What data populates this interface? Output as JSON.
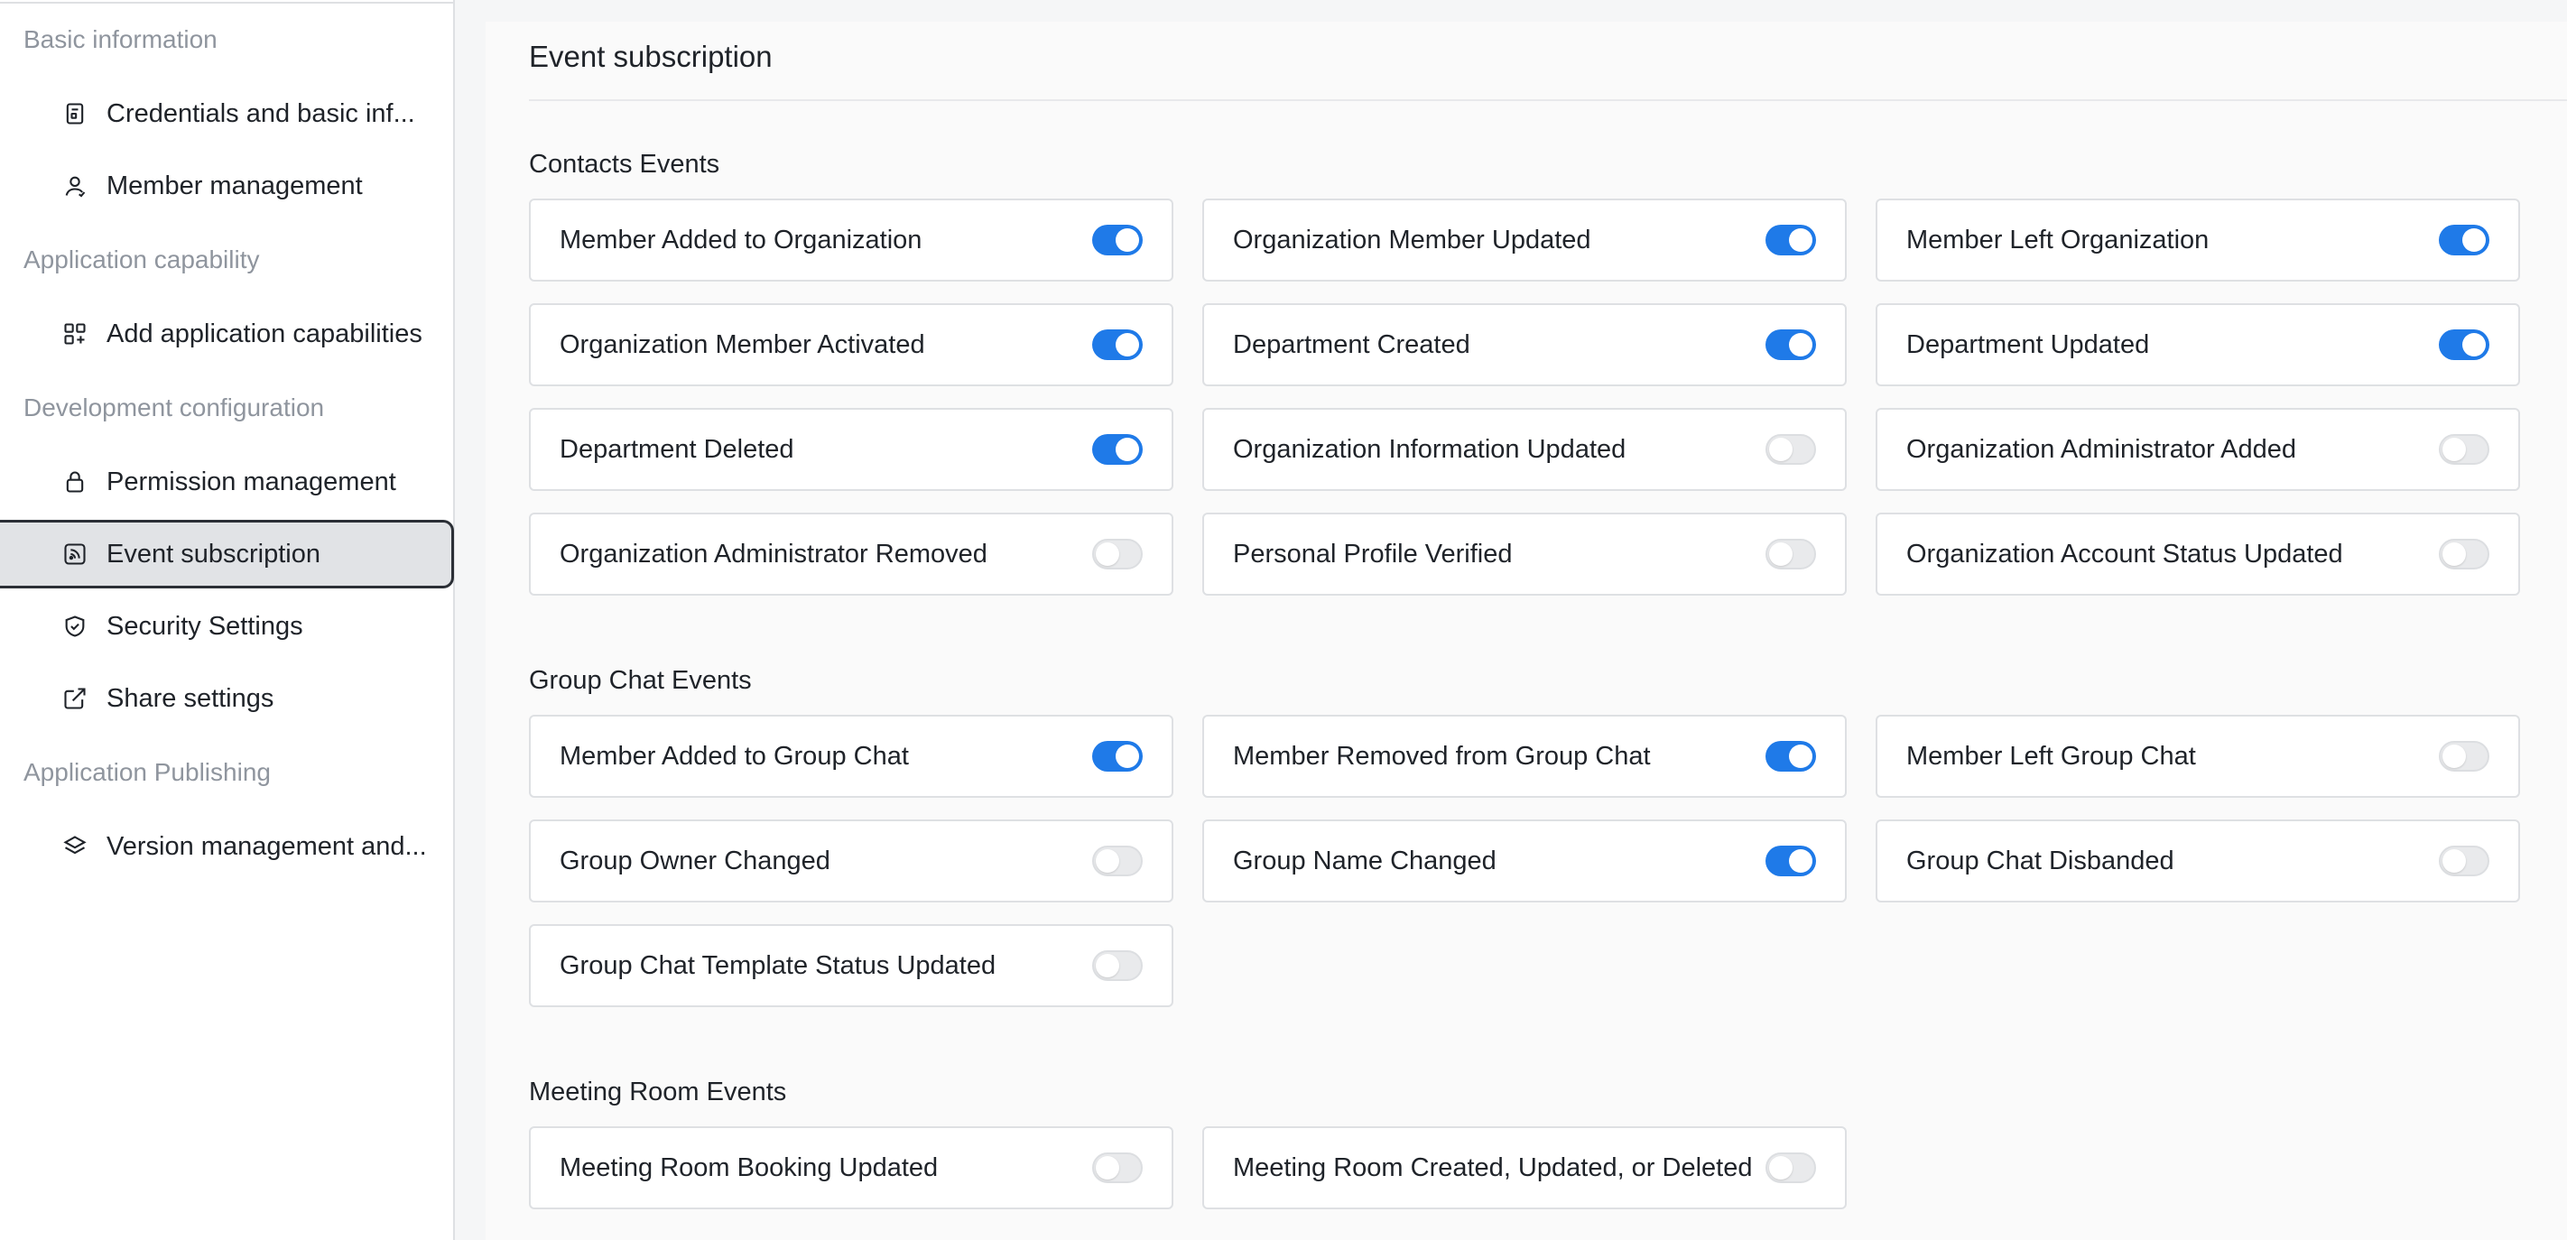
{
  "sidebar": {
    "groups": {
      "basic": "Basic information",
      "capability": "Application capability",
      "development": "Development configuration",
      "publishing": "Application Publishing"
    },
    "items": [
      {
        "label": "Credentials and basic inf...",
        "icon": "credentials-icon"
      },
      {
        "label": "Member management",
        "icon": "user-icon"
      },
      {
        "label": "Add application capabilities",
        "icon": "apps-add-icon"
      },
      {
        "label": "Permission management",
        "icon": "lock-icon"
      },
      {
        "label": "Event subscription",
        "icon": "rss-icon",
        "active": true
      },
      {
        "label": "Security Settings",
        "icon": "shield-icon"
      },
      {
        "label": "Share settings",
        "icon": "share-external-icon"
      },
      {
        "label": "Version management and...",
        "icon": "layers-icon"
      }
    ]
  },
  "main": {
    "title": "Event subscription",
    "sections": [
      {
        "title": "Contacts Events",
        "events": [
          {
            "label": "Member Added to Organization",
            "enabled": true
          },
          {
            "label": "Organization Member Updated",
            "enabled": true
          },
          {
            "label": "Member Left Organization",
            "enabled": true
          },
          {
            "label": "Organization Member Activated",
            "enabled": true
          },
          {
            "label": "Department Created",
            "enabled": true
          },
          {
            "label": "Department Updated",
            "enabled": true
          },
          {
            "label": "Department Deleted",
            "enabled": true
          },
          {
            "label": "Organization Information Updated",
            "enabled": false
          },
          {
            "label": "Organization Administrator Added",
            "enabled": false
          },
          {
            "label": "Organization Administrator Removed",
            "enabled": false
          },
          {
            "label": "Personal Profile Verified",
            "enabled": false
          },
          {
            "label": "Organization Account Status Updated",
            "enabled": false
          }
        ]
      },
      {
        "title": "Group Chat Events",
        "events": [
          {
            "label": "Member Added to Group Chat",
            "enabled": true
          },
          {
            "label": "Member Removed from Group Chat",
            "enabled": true
          },
          {
            "label": "Member Left Group Chat",
            "enabled": false
          },
          {
            "label": "Group Owner Changed",
            "enabled": false
          },
          {
            "label": "Group Name Changed",
            "enabled": true
          },
          {
            "label": "Group Chat Disbanded",
            "enabled": false
          },
          {
            "label": "Group Chat Template Status Updated",
            "enabled": false
          }
        ]
      },
      {
        "title": "Meeting Room Events",
        "events": [
          {
            "label": "Meeting Room Booking Updated",
            "enabled": false
          },
          {
            "label": "Meeting Room Created, Updated, or Deleted",
            "enabled": false
          }
        ]
      }
    ]
  },
  "colors": {
    "toggle_on": "#1f7ae8",
    "toggle_off": "#e9eaec",
    "active_nav_bg": "#e1e3e6"
  }
}
